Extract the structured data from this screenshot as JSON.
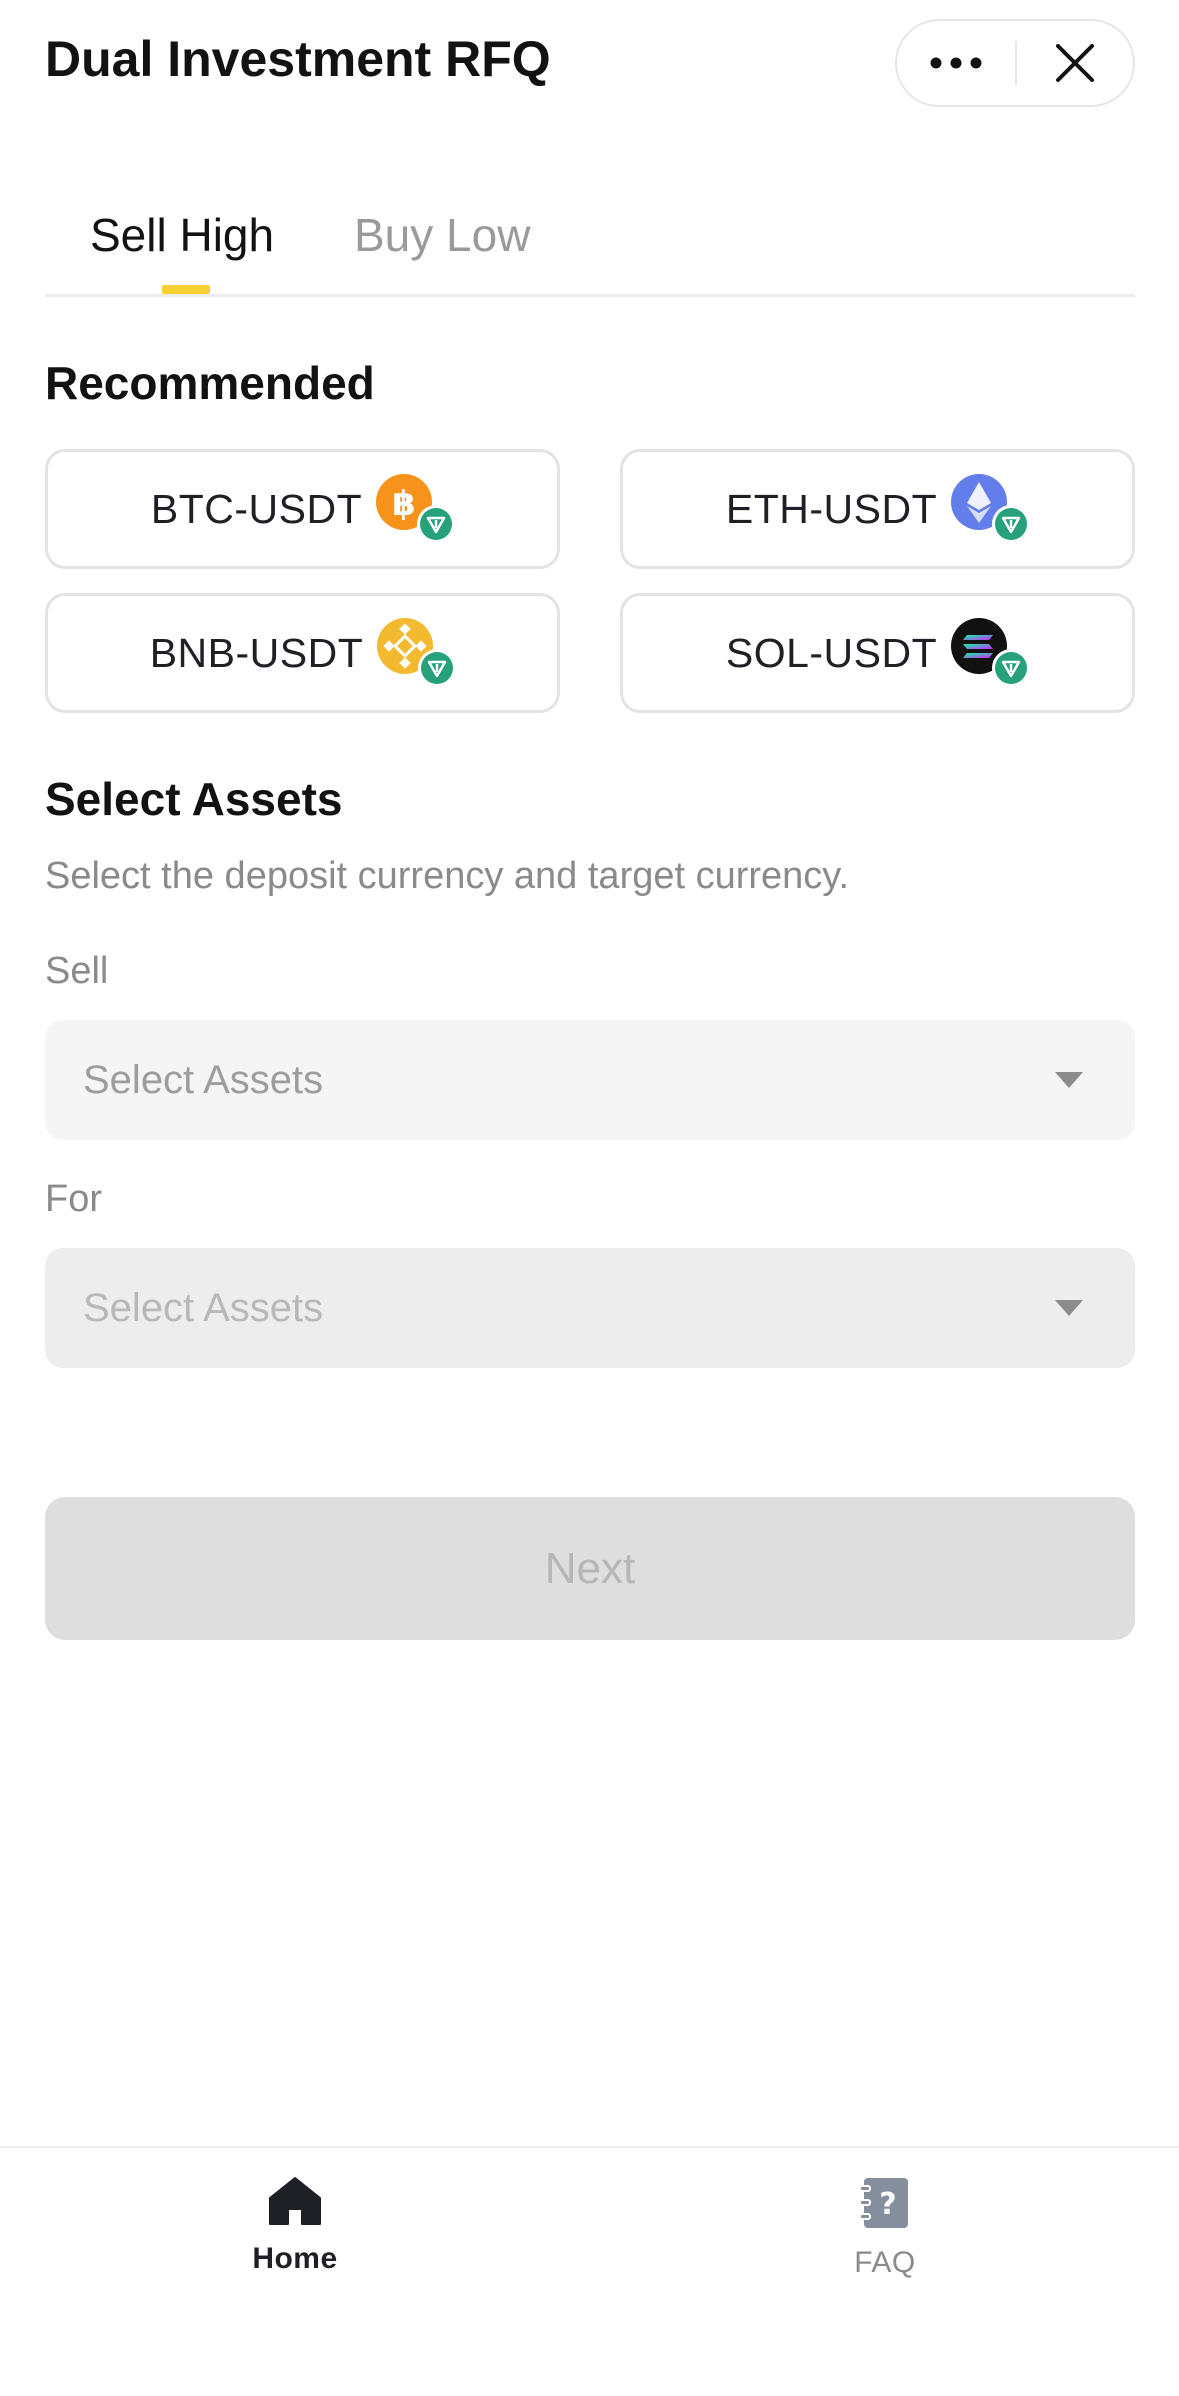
{
  "header": {
    "title": "Dual Investment RFQ",
    "more_icon": "more-dots-icon",
    "close_icon": "close-icon"
  },
  "tabs": [
    {
      "label": "Sell High",
      "active": true
    },
    {
      "label": "Buy Low",
      "active": false
    }
  ],
  "recommended": {
    "title": "Recommended",
    "pairs": [
      {
        "label": "BTC-USDT",
        "icon": "btc-usdt-icon",
        "base_color": "#f7931a"
      },
      {
        "label": "ETH-USDT",
        "icon": "eth-usdt-icon",
        "base_color": "#627eea"
      },
      {
        "label": "BNB-USDT",
        "icon": "bnb-usdt-icon",
        "base_color": "#f3ba2f"
      },
      {
        "label": "SOL-USDT",
        "icon": "sol-usdt-icon",
        "base_color": "#111111"
      }
    ],
    "quote_color": "#26a17b"
  },
  "select_assets": {
    "title": "Select Assets",
    "helper": "Select the deposit currency and target currency.",
    "sell": {
      "label": "Sell",
      "placeholder": "Select Assets"
    },
    "for": {
      "label": "For",
      "placeholder": "Select Assets"
    }
  },
  "next_button": {
    "label": "Next",
    "enabled": false
  },
  "bottom_nav": [
    {
      "label": "Home",
      "icon": "home-icon",
      "active": true
    },
    {
      "label": "FAQ",
      "icon": "faq-icon",
      "active": false
    }
  ],
  "colors": {
    "accent": "#f7d033",
    "text_primary": "#1e2026",
    "text_secondary": "#8a8a8a"
  }
}
